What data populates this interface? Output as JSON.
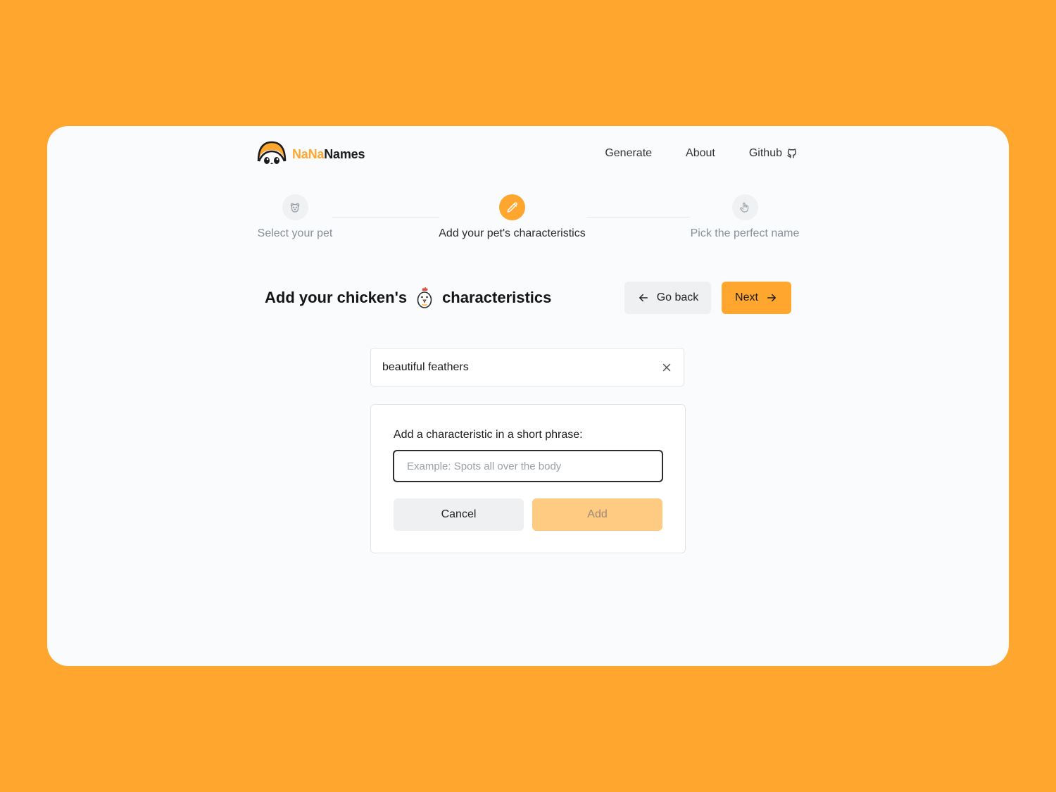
{
  "brand": {
    "part1": "NaNa",
    "part2": "Names"
  },
  "nav": {
    "generate": "Generate",
    "about": "About",
    "github": "Github"
  },
  "steps": [
    {
      "label": "Select your pet",
      "icon": "dog-face-icon",
      "state": "done"
    },
    {
      "label": "Add your pet's characteristics",
      "icon": "pencil-icon",
      "state": "active"
    },
    {
      "label": "Pick the perfect name",
      "icon": "pointer-hand-icon",
      "state": "upcoming"
    }
  ],
  "title": {
    "before": "Add your chicken's",
    "after": "characteristics",
    "icon": "chicken-icon"
  },
  "buttons": {
    "back": "Go back",
    "next": "Next"
  },
  "characteristics": [
    {
      "text": "beautiful feathers"
    }
  ],
  "add_panel": {
    "label": "Add a characteristic in a short phrase:",
    "placeholder": "Example: Spots all over the body",
    "value": "",
    "cancel": "Cancel",
    "add": "Add"
  },
  "colors": {
    "accent": "#FFA62F",
    "background": "#FFA62F",
    "card": "#F9FBFC",
    "add_disabled": "#FFCB83"
  }
}
